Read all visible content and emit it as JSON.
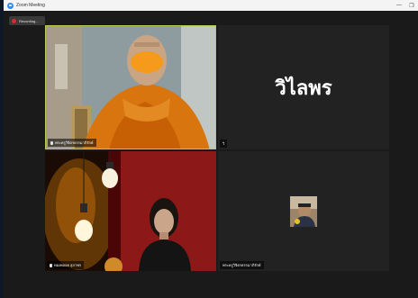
{
  "window": {
    "title": "Zoom Meeting",
    "minimize_glyph": "—",
    "restore_glyph": "❐",
    "accent": "#2d8cff"
  },
  "recording": {
    "label": "Recording...",
    "indicator_color": "#e02828"
  },
  "participants": [
    {
      "name": "พระครูวิจิตรธรรมาภิรักษ์",
      "icon": "mic-icon",
      "active_speaker": true,
      "highlight_color": "#b5cc52"
    },
    {
      "name": "วิไลพร",
      "small_label": "วิ",
      "video": false
    },
    {
      "name": "ทองพลอย สุภาพร",
      "icon": "mic-icon",
      "video": true
    },
    {
      "name": "พระครูวิจิตรธรรมาภิรักษ์",
      "video": false,
      "avatar": true
    }
  ]
}
